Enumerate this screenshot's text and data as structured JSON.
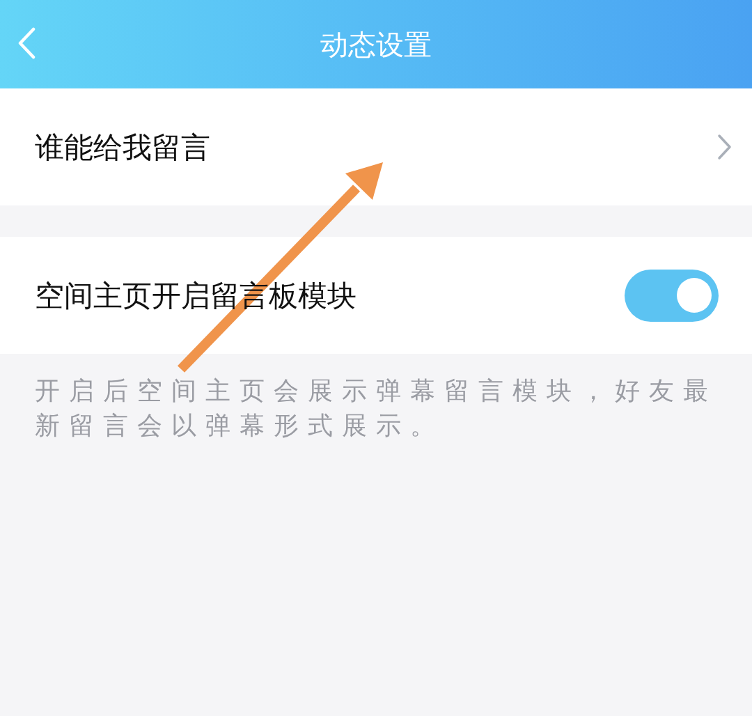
{
  "header": {
    "title": "动态设置"
  },
  "rows": [
    {
      "kind": "link",
      "label": "谁能给我留言"
    },
    {
      "kind": "toggle",
      "label": "空间主页开启留言板模块",
      "on": true
    }
  ],
  "description": "开启后空间主页会展示弹幕留言模块，好友最新留言会以弹幕形式展示。"
}
